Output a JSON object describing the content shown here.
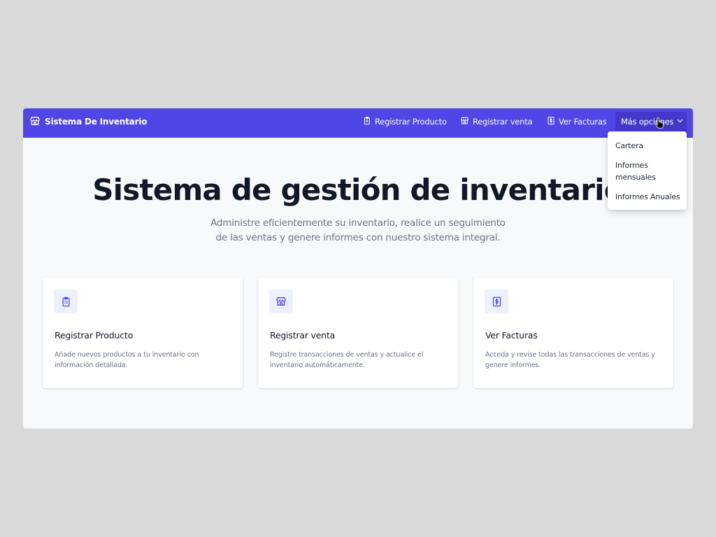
{
  "navbar": {
    "brand": {
      "label": "Sistema De Inventario",
      "icon": "store-icon"
    },
    "links": [
      {
        "label": "Registrar Producto",
        "icon": "clipboard-icon"
      },
      {
        "label": "Registrar venta",
        "icon": "store-icon"
      },
      {
        "label": "Ver Facturas",
        "icon": "dollar-receipt-icon"
      }
    ],
    "more": {
      "label": "Más opciones",
      "icon": "chevron-down-icon"
    }
  },
  "dropdown": {
    "items": [
      {
        "label": "Cartera"
      },
      {
        "label": "Informes mensuales"
      },
      {
        "label": "Informes Anuales"
      }
    ]
  },
  "hero": {
    "title": "Sistema de gestión de inventario",
    "subtitle": "Administre eficientemente su inventario, realice un seguimiento de las ventas y genere informes con nuestro sistema integral."
  },
  "cards": [
    {
      "icon": "clipboard-icon",
      "title": "Registrar Producto",
      "description": "Añade nuevos productos a tu inventario con información detallada."
    },
    {
      "icon": "store-icon",
      "title": "Registrar venta",
      "description": "Registre transacciones de ventas y actualice el inventario automáticamente."
    },
    {
      "icon": "dollar-receipt-icon",
      "title": "Ver Facturas",
      "description": "Acceda y revise todas las transacciones de ventas y genere informes."
    }
  ],
  "colors": {
    "primary": "#4f46e5",
    "primary_dark": "#4338ca",
    "background": "#f8f9fb",
    "heading": "#111827",
    "muted": "#6b7280"
  }
}
